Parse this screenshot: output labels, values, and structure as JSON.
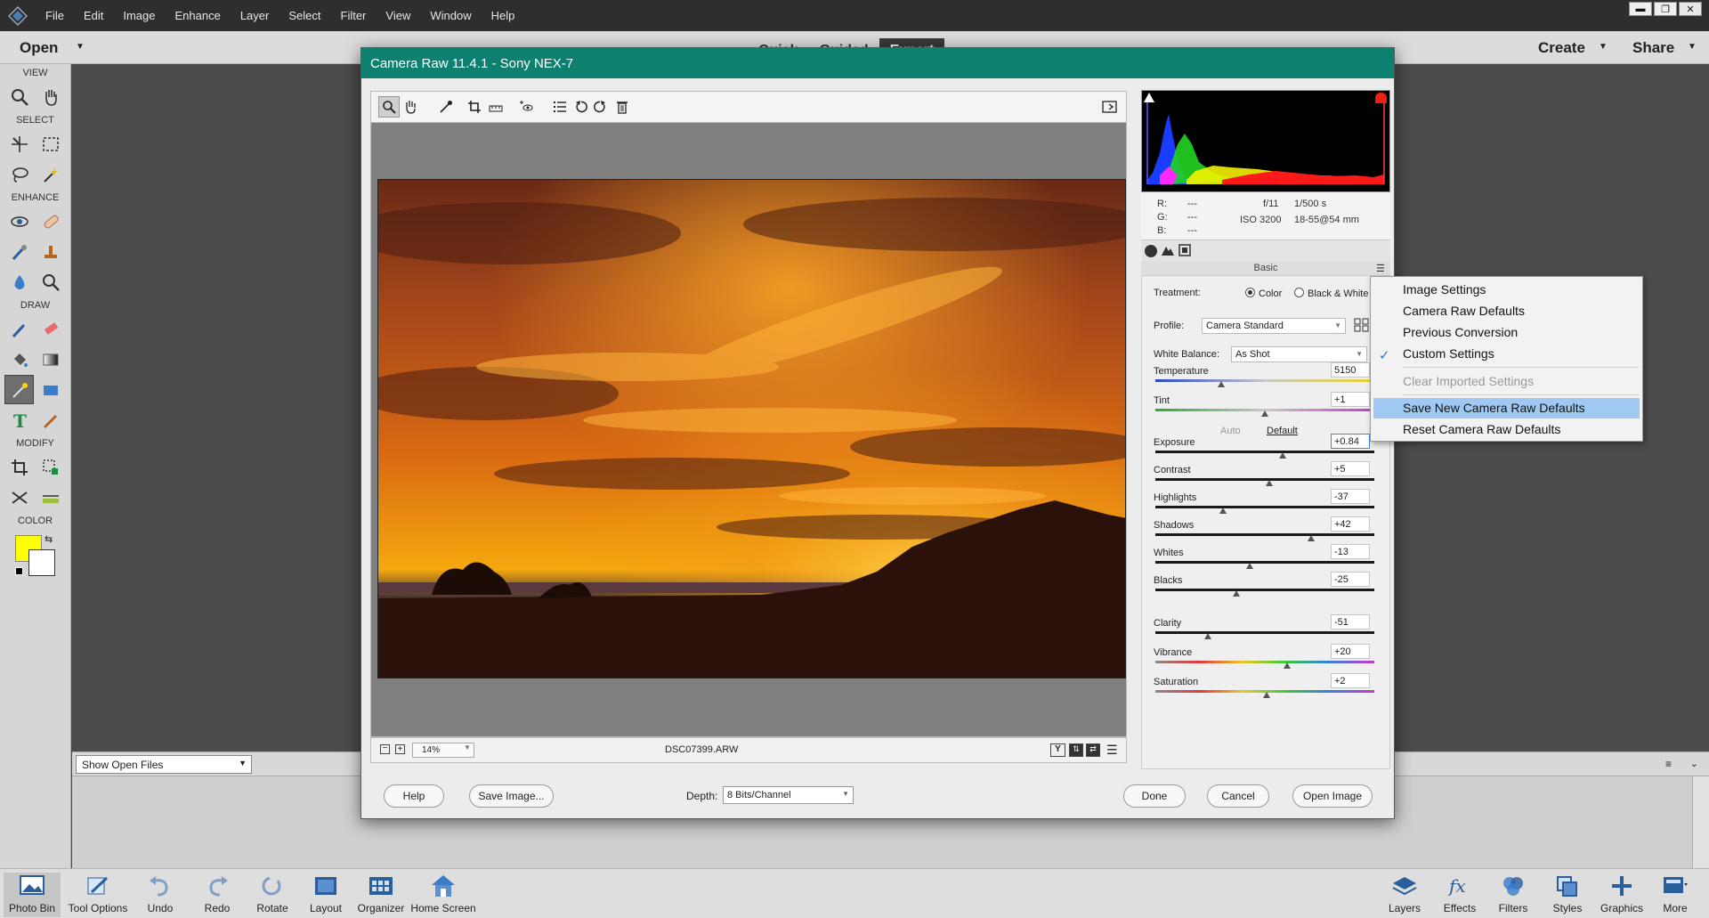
{
  "menubar": {
    "items": [
      "File",
      "Edit",
      "Image",
      "Enhance",
      "Layer",
      "Select",
      "Filter",
      "View",
      "Window",
      "Help"
    ],
    "window_buttons": [
      "▬",
      "❐",
      "✕"
    ]
  },
  "modebar": {
    "open_label": "Open",
    "tabs": [
      "Quick",
      "Guided",
      "Expert"
    ],
    "create_label": "Create",
    "share_label": "Share"
  },
  "toolbox": {
    "sections": [
      "VIEW",
      "SELECT",
      "ENHANCE",
      "DRAW",
      "MODIFY",
      "COLOR"
    ],
    "foreground_color": "#ffff00",
    "background_color": "#ffffff"
  },
  "bin": {
    "select_value": "Show Open Files"
  },
  "taskbar": {
    "left": [
      "Photo Bin",
      "Tool Options",
      "Undo",
      "Redo",
      "Rotate",
      "Layout",
      "Organizer",
      "Home Screen"
    ],
    "right": [
      "Layers",
      "Effects",
      "Filters",
      "Styles",
      "Graphics",
      "More"
    ]
  },
  "dialog": {
    "title": "Camera Raw 11.4.1  -  Sony NEX-7",
    "accent_color": "#0e8070",
    "zoom": "14%",
    "filename": "DSC07399.ARW",
    "footer": {
      "help": "Help",
      "save_image": "Save Image...",
      "depth_label": "Depth:",
      "depth_value": "8 Bits/Channel",
      "done": "Done",
      "cancel": "Cancel",
      "open_image": "Open Image"
    },
    "meta": {
      "r": "R:",
      "r_val": "---",
      "g": "G:",
      "g_val": "---",
      "b": "B:",
      "b_val": "---",
      "aperture": "f/11",
      "shutter": "1/500 s",
      "iso": "ISO 3200",
      "lens": "18-55@54 mm"
    },
    "panel_title": "Basic",
    "treatment": {
      "label": "Treatment:",
      "color": "Color",
      "bw": "Black & White",
      "selected": "Color"
    },
    "profile": {
      "label": "Profile:",
      "value": "Camera Standard"
    },
    "white_balance": {
      "label": "White Balance:",
      "value": "As Shot"
    },
    "auto": "Auto",
    "default": "Default",
    "sliders": [
      {
        "name": "Temperature",
        "value": "5150",
        "fraction": 0.3
      },
      {
        "name": "Tint",
        "value": "+1",
        "fraction": 0.5
      },
      {
        "name": "Exposure",
        "value": "+0.84",
        "fraction": 0.58
      },
      {
        "name": "Contrast",
        "value": "+5",
        "fraction": 0.52
      },
      {
        "name": "Highlights",
        "value": "-37",
        "fraction": 0.31
      },
      {
        "name": "Shadows",
        "value": "+42",
        "fraction": 0.71
      },
      {
        "name": "Whites",
        "value": "-13",
        "fraction": 0.43
      },
      {
        "name": "Blacks",
        "value": "-25",
        "fraction": 0.37
      },
      {
        "name": "Clarity",
        "value": "-51",
        "fraction": 0.24
      },
      {
        "name": "Vibrance",
        "value": "+20",
        "fraction": 0.6
      },
      {
        "name": "Saturation",
        "value": "+2",
        "fraction": 0.51
      }
    ]
  },
  "flyout": {
    "items": [
      {
        "label": "Image Settings",
        "state": "normal"
      },
      {
        "label": "Camera Raw Defaults",
        "state": "normal"
      },
      {
        "label": "Previous Conversion",
        "state": "normal"
      },
      {
        "label": "Custom Settings",
        "state": "checked"
      },
      {
        "label": "Clear Imported Settings",
        "state": "disabled"
      },
      {
        "label": "Save New Camera Raw Defaults",
        "state": "highlighted"
      },
      {
        "label": "Reset Camera Raw Defaults",
        "state": "normal"
      }
    ],
    "highlight_color": "#9fc9f2"
  }
}
